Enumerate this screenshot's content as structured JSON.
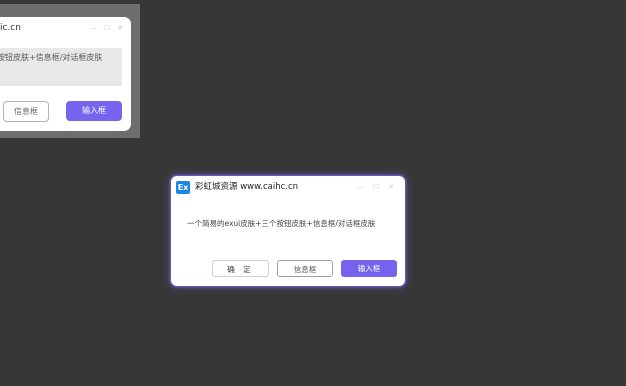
{
  "colors": {
    "desktop": "#373737",
    "accent": "#7563ee",
    "logo": "#1b86e6"
  },
  "background_window": {
    "title": "ic.cn",
    "message": "按钮皮肤+信息框/对话框皮肤",
    "info_button": "信息框",
    "input_button": "输入框"
  },
  "dialog": {
    "logo_text": "Ex",
    "logo_icon": "exui-logo-icon",
    "title": "彩虹城资源 www.caihc.cn",
    "controls": {
      "minimize": "—",
      "maximize": "☐",
      "close": "✕"
    },
    "message": "一个简易的exui皮肤+三个按钮皮肤+信息框/对话框皮肤",
    "buttons": {
      "ok": "确 定",
      "info": "信息框",
      "input": "输入框"
    }
  }
}
